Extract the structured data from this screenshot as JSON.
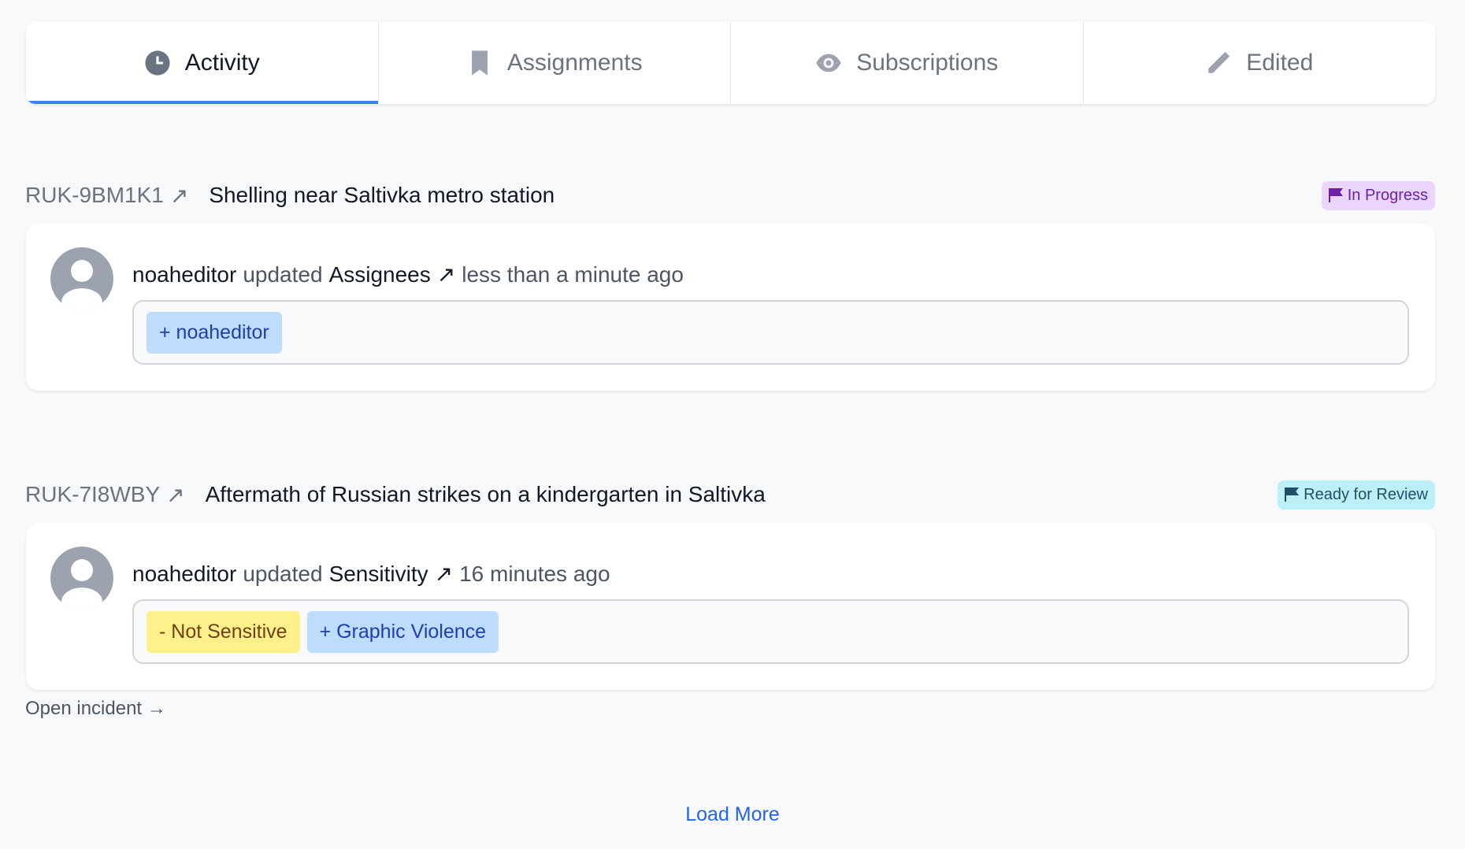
{
  "tabs": [
    {
      "label": "Activity",
      "icon": "clock-icon",
      "active": true
    },
    {
      "label": "Assignments",
      "icon": "bookmark-icon"
    },
    {
      "label": "Subscriptions",
      "icon": "eye-icon"
    },
    {
      "label": "Edited",
      "icon": "pencil-icon"
    }
  ],
  "incidents": [
    {
      "ref": "RUK-9BM1K1",
      "title": "Shelling near Saltivka metro station",
      "status": "In Progress",
      "status_bg": "#e9d5ff",
      "status_color": "#6b21a8",
      "activity": {
        "user": "noaheditor",
        "verb": "updated",
        "field": "Assignees",
        "time": "less than a minute ago",
        "changes": [
          "+ noaheditor"
        ]
      }
    },
    {
      "ref": "RUK-7I8WBY",
      "title": "Aftermath of Russian strikes on a kindergarten in Saltivka",
      "status": "Ready for Review",
      "status_bg": "#bbf0f8",
      "status_color": "#1f4f66",
      "activity": {
        "user": "noaheditor",
        "verb": "updated",
        "field": "Sensitivity",
        "time": "16 minutes ago",
        "changes": [
          "- Not Sensitive",
          "+ Graphic Violence"
        ]
      }
    }
  ],
  "open_incident": "Open incident →",
  "load_more": "Load More"
}
